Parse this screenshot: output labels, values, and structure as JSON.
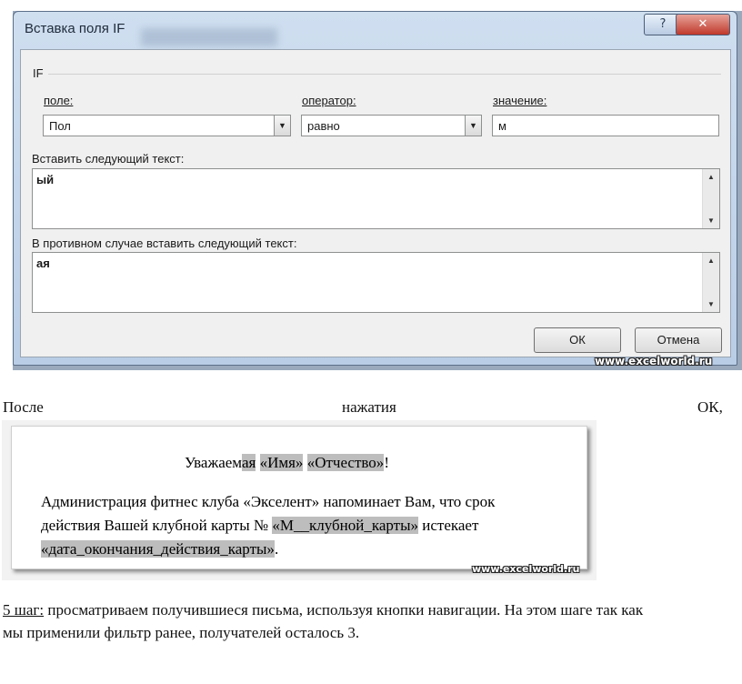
{
  "dialog": {
    "title": "Вставка поля IF",
    "help_glyph": "?",
    "close_glyph": "✕",
    "group_label": "IF",
    "field_label": "поле:",
    "field_value": "Пол",
    "operator_label": "оператор:",
    "operator_value": "равно",
    "value_label": "значение:",
    "value_value": "м",
    "insert_label": "Вставить следующий текст:",
    "insert_text": "ый",
    "else_label": "В противном случае вставить следующий текст:",
    "else_text": "ая",
    "ok_label": "ОК",
    "cancel_label": "Отмена",
    "watermark": "www.excelworld.ru",
    "icons": {
      "dropdown": "chevron-down-icon",
      "scroll_up": "scroll-up-icon",
      "scroll_down": "scroll-down-icon"
    }
  },
  "paragraph1": {
    "word1": "После",
    "word2": "нажатия",
    "word3": "ОК,"
  },
  "letter": {
    "greeting_prefix": "Уважаем",
    "greeting_field1": "ая",
    "greeting_sp1": " ",
    "greeting_field2": "«Имя»",
    "greeting_sp2": " ",
    "greeting_field3": "«Отчество»",
    "greeting_end": "!",
    "line2": "Администрация фитнес клуба «Экселент» напоминает Вам, что срок",
    "line3_pre": "действия Вашей клубной карты № ",
    "line3_field": "«М__клубной_карты»",
    "line3_post": " истекает",
    "line4_field": "«дата_окончания_действия_карты»",
    "line4_end": ".",
    "watermark": "www.excelworld.ru"
  },
  "paragraph2": {
    "step_label": "5 шаг:",
    "line1_rest": " просматриваем получившиеся письма, используя кнопки навигации. На этом шаге так как",
    "line2": "мы применили фильтр ранее, получателей осталось 3."
  }
}
